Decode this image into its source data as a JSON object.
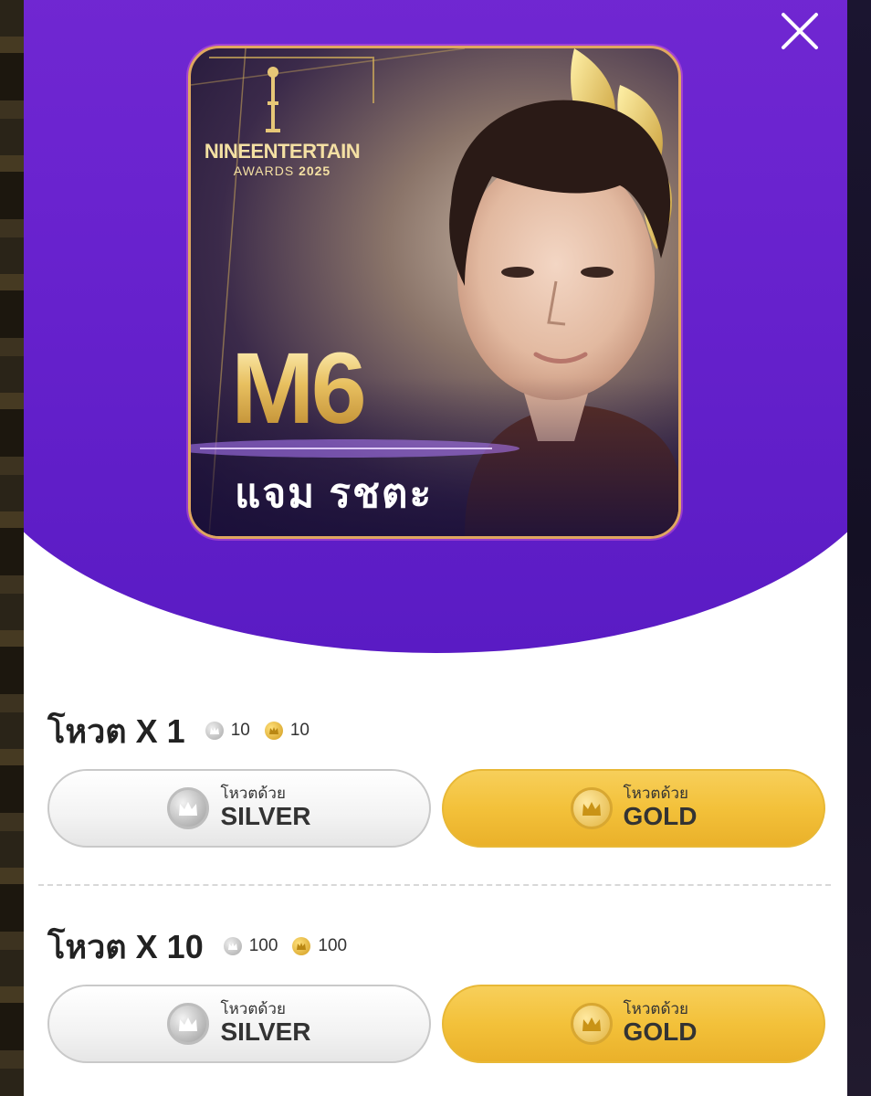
{
  "modal": {
    "close_label": "close"
  },
  "poster": {
    "brand_line1": "NINEENTERTAIN",
    "brand_line2": "AWARDS",
    "brand_year": "2025",
    "code": "M6",
    "name": "แจม รชตะ"
  },
  "votes": [
    {
      "title": "โหวต X 1",
      "silver_price": "10",
      "gold_price": "10",
      "silver_sub": "โหวตด้วย",
      "silver_label": "SILVER",
      "gold_sub": "โหวตด้วย",
      "gold_label": "GOLD"
    },
    {
      "title": "โหวต X 10",
      "silver_price": "100",
      "gold_price": "100",
      "silver_sub": "โหวตด้วย",
      "silver_label": "SILVER",
      "gold_sub": "โหวตด้วย",
      "gold_label": "GOLD"
    }
  ],
  "colors": {
    "purple": "#6a23cf",
    "gold": "#f3c13a",
    "silver": "#e6e6e6"
  }
}
